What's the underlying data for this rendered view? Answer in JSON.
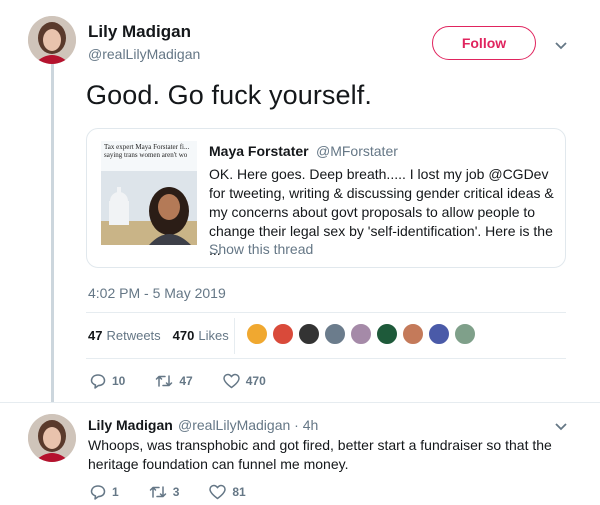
{
  "tweet": {
    "author_name": "Lily Madigan",
    "author_handle": "@realLilyMadigan",
    "follow_label": "Follow",
    "text": "Good. Go fuck yourself.",
    "timestamp": "4:02 PM - 5 May 2019",
    "retweets_count": "47",
    "retweets_label": "Retweets",
    "likes_count": "470",
    "likes_label": "Likes",
    "actions": {
      "reply": "10",
      "retweet": "47",
      "like": "470"
    }
  },
  "quote": {
    "thumb_headline": "Tax expert Maya Forstater fi... saying trans women aren't wo",
    "author_name": "Maya Forstater",
    "author_handle": "@MForstater",
    "text": "OK. Here goes. Deep breath..... I lost my job @CGDev for tweeting, writing & discussing gender critical ideas & my concerns about govt proposals to allow people to change their legal sex by 'self-identification'. Here is the ...",
    "show_thread": "Show this thread"
  },
  "reply": {
    "author_name": "Lily Madigan",
    "meta": "@realLilyMadigan · 4h",
    "text": "Whoops, was transphobic and got fired, better start a fundraiser so that the heritage foundation can funnel me money.",
    "actions": {
      "reply": "1",
      "retweet": "3",
      "like": "81"
    }
  },
  "icons": [
    "chevron-down-icon",
    "reply-icon",
    "retweet-icon",
    "heart-icon"
  ],
  "colors": {
    "accent": "#e0245e",
    "muted": "#657786",
    "border": "#e1e8ed",
    "link": "#1da1f2"
  }
}
